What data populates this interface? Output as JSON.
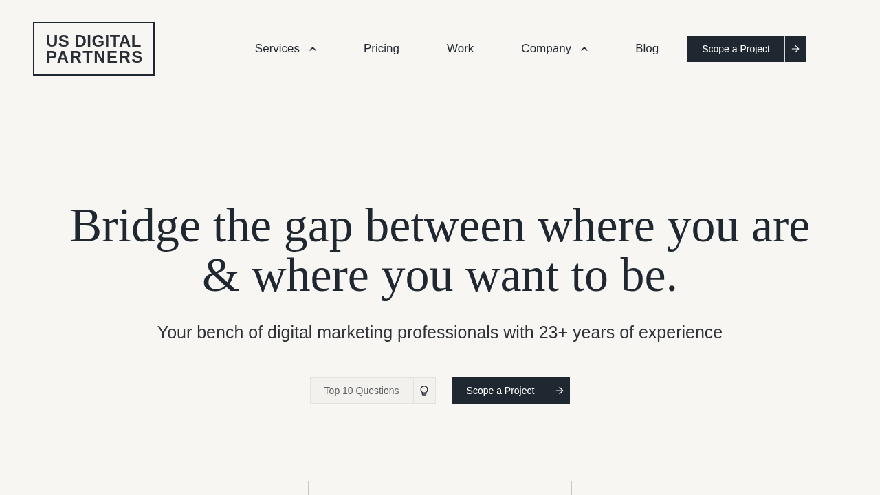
{
  "logo": {
    "lines": [
      "US DIGITAL",
      "PARTNERS"
    ]
  },
  "nav": {
    "items": [
      {
        "label": "Services",
        "has_menu": true
      },
      {
        "label": "Pricing",
        "has_menu": false
      },
      {
        "label": "Work",
        "has_menu": false
      },
      {
        "label": "Company",
        "has_menu": true
      },
      {
        "label": "Blog",
        "has_menu": false
      }
    ],
    "cta": {
      "label": "Scope a Project"
    }
  },
  "hero": {
    "headline": {
      "lines": [
        "Bridge the gap between where you are",
        "& where you want to be."
      ]
    },
    "subtitle": "Your bench of digital marketing professionals with 23+ years of experience",
    "buttons": [
      {
        "kind": "secondary",
        "label": "Top 10 Questions"
      },
      {
        "kind": "primary",
        "label": "Scope a Project"
      }
    ]
  }
}
